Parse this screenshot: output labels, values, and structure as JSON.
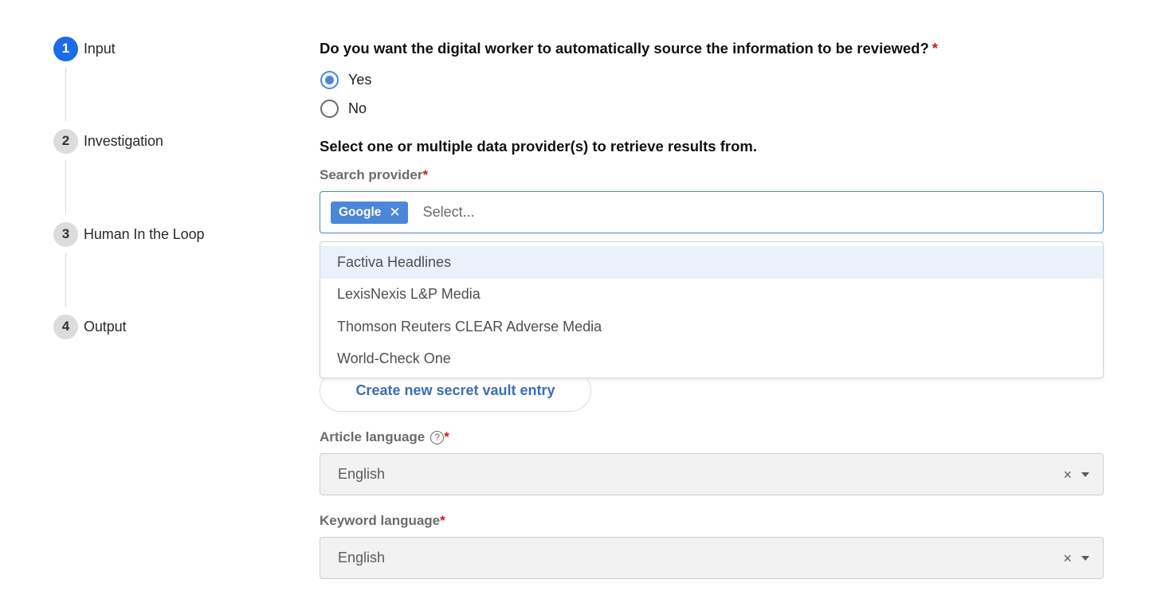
{
  "stepper": {
    "steps": [
      {
        "number": "1",
        "label": "Input",
        "active": true
      },
      {
        "number": "2",
        "label": "Investigation",
        "active": false
      },
      {
        "number": "3",
        "label": "Human In the Loop",
        "active": false
      },
      {
        "number": "4",
        "label": "Output",
        "active": false
      }
    ]
  },
  "form": {
    "auto_source": {
      "question": "Do you want the digital worker to automatically source the information to be reviewed?",
      "required_mark": "*",
      "options": [
        {
          "label": "Yes",
          "checked": true
        },
        {
          "label": "No",
          "checked": false
        }
      ]
    },
    "providers": {
      "section_title": "Select one or multiple data provider(s) to retrieve results from.",
      "search_provider_label": "Search provider",
      "required_mark": "*",
      "selected_chips": [
        "Google"
      ],
      "chip_remove_glyph": "✕",
      "placeholder": "Select...",
      "dropdown_options": [
        "Factiva Headlines",
        "LexisNexis L&P Media",
        "Thomson Reuters CLEAR Adverse Media",
        "World-Check One"
      ],
      "highlighted_option_index": 0
    },
    "vault_button_label": "Create new secret vault entry",
    "article_language": {
      "label": "Article language",
      "help_glyph": "?",
      "required_mark": "*",
      "value": "English",
      "clear_glyph": "×"
    },
    "keyword_language": {
      "label": "Keyword language",
      "required_mark": "*",
      "value": "English",
      "clear_glyph": "×"
    }
  },
  "colors": {
    "active_step": "#1a6ce8",
    "accent": "#4b87d8",
    "required": "#d0172b",
    "link_text": "#3b6fb3",
    "option_highlight": "#ebf1fa"
  },
  "icons": {
    "chip_remove": "close-icon",
    "help": "help-circle-icon",
    "select_clear": "clear-icon",
    "select_caret": "caret-down-icon"
  }
}
